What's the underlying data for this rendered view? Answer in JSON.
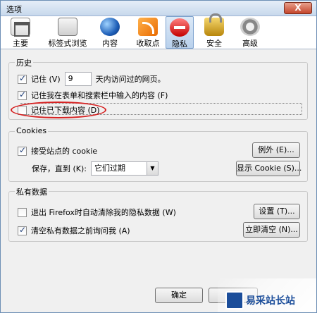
{
  "window": {
    "title": "选项",
    "close_label": "X"
  },
  "tabs": [
    {
      "label": "主要",
      "icon": "general-icon"
    },
    {
      "label": "标签式浏览",
      "icon": "tabs-icon"
    },
    {
      "label": "内容",
      "icon": "content-globe-icon"
    },
    {
      "label": "收取点",
      "icon": "feed-icon"
    },
    {
      "label": "隐私",
      "icon": "privacy-icon",
      "active": true
    },
    {
      "label": "安全",
      "icon": "padlock-icon"
    },
    {
      "label": "高级",
      "icon": "gear-icon"
    }
  ],
  "history": {
    "title": "历史",
    "remember_label": "记住 (V)",
    "days_value": "9",
    "days_suffix": "天内访问过的网页。",
    "forms_label": "记住我在表单和搜索栏中输入的内容 (F)",
    "downloads_label": "记住已下载内容 (D)"
  },
  "cookies": {
    "title": "Cookies",
    "accept_label": "接受站点的 cookie",
    "exceptions_button": "例外 (E)...",
    "keep_label": "保存，直到 (K):",
    "keep_value": "它们过期",
    "show_button": "显示 Cookie (S)..."
  },
  "private_data": {
    "title": "私有数据",
    "clear_on_exit_label": "退出 Firefox时自动清除我的隐私数据 (W)",
    "settings_button": "设置 (T)...",
    "ask_label": "清空私有数据之前询问我 (A)",
    "clear_now_button": "立即清空 (N)..."
  },
  "footer": {
    "ok": "确定"
  },
  "watermark": {
    "text": "易采站长站"
  },
  "colors": {
    "highlight": "#d62121",
    "active_tab": "#b9d1ec"
  }
}
